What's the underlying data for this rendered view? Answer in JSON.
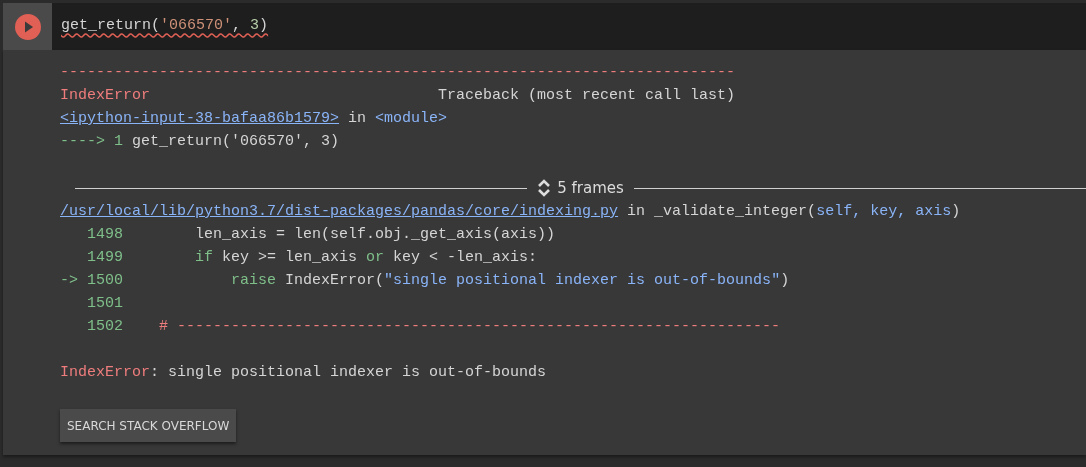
{
  "cell": {
    "input": [
      {
        "kind": "code",
        "text": "get_return("
      },
      {
        "kind": "string",
        "text": "'066570'"
      },
      {
        "kind": "code",
        "text": ", "
      },
      {
        "kind": "number",
        "text": "3"
      },
      {
        "kind": "code",
        "text": ")"
      }
    ],
    "has_error_underline": true
  },
  "output": [
    {
      "kind": "text",
      "segments": [
        {
          "kind": "error",
          "text": "---------------------------------------------------------------------------"
        }
      ]
    },
    {
      "kind": "text",
      "segments": [
        {
          "kind": "error",
          "text": "IndexError"
        },
        {
          "kind": "heading",
          "text": "Traceback (most recent call last)"
        }
      ]
    },
    {
      "kind": "text",
      "segments": [
        {
          "kind": "link",
          "text": "<ipython-input-38-bafaa86b1579>"
        },
        {
          "kind": "plain",
          "text": " in "
        },
        {
          "kind": "name",
          "text": "<module>"
        }
      ]
    },
    {
      "kind": "text",
      "segments": [
        {
          "kind": "arrow",
          "text": "----> 1"
        },
        {
          "kind": "plain",
          "text": " get_return('066570', 3)"
        }
      ]
    },
    {
      "kind": "blank"
    },
    {
      "kind": "frames",
      "label": "5 frames"
    },
    {
      "kind": "text",
      "segments": [
        {
          "kind": "link",
          "text": "/usr/local/lib/python3.7/dist-packages/pandas/core/indexing.py"
        },
        {
          "kind": "plain",
          "text": " in _validate_integer("
        },
        {
          "kind": "name",
          "text": "self, key, axis"
        },
        {
          "kind": "plain",
          "text": ")"
        }
      ]
    },
    {
      "kind": "frame_line",
      "number": "1498",
      "segments": [
        {
          "kind": "plain",
          "text": "        len_axis = len(self.obj._get_axis(axis))"
        }
      ]
    },
    {
      "kind": "frame_line",
      "number": "1499",
      "segments": [
        {
          "kind": "keyword",
          "text": "        if"
        },
        {
          "kind": "plain",
          "text": " key >= len_axis "
        },
        {
          "kind": "keyword",
          "text": "or"
        },
        {
          "kind": "plain",
          "text": " key < -len_axis:"
        }
      ]
    },
    {
      "kind": "frame_line",
      "marker": "->",
      "number": "1500",
      "segments": [
        {
          "kind": "keyword",
          "text": "            raise"
        },
        {
          "kind": "plain",
          "text": " IndexError("
        },
        {
          "kind": "name",
          "text": "\"single positional indexer is out-of-bounds\""
        },
        {
          "kind": "plain",
          "text": ")"
        }
      ]
    },
    {
      "kind": "frame_line",
      "number": "1501"
    },
    {
      "kind": "frame_line",
      "number": "1502",
      "segments": [
        {
          "kind": "error",
          "text": "    # -------------------------------------------------------------------"
        }
      ]
    },
    {
      "kind": "blank"
    },
    {
      "kind": "text",
      "segments": [
        {
          "kind": "error",
          "text": "IndexError"
        },
        {
          "kind": "plain",
          "text": ": single positional indexer is out-of-bounds"
        }
      ]
    }
  ],
  "button": "SEARCH STACK OVERFLOW"
}
